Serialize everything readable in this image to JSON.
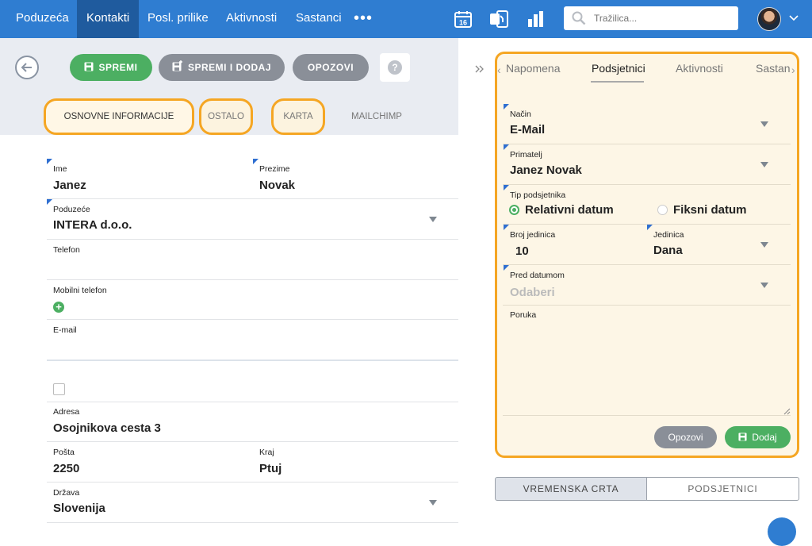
{
  "topnav": {
    "items": [
      "Poduzeća",
      "Kontakti",
      "Posl. prilike",
      "Aktivnosti",
      "Sastanci"
    ],
    "active_index": 1,
    "more_label": "•••",
    "search_placeholder": "Tražilica...",
    "calendar_day": "16"
  },
  "toolbar": {
    "save_label": "SPREMI",
    "save_add_label": "SPREMI I DODAJ",
    "cancel_label": "OPOZOVI",
    "help_label": "?"
  },
  "form_tabs": [
    "OSNOVNE INFORMACIJE",
    "OSTALO",
    "KARTA",
    "MAILCHIMP"
  ],
  "form": {
    "ime_label": "Ime",
    "ime_value": "Janez",
    "prezime_label": "Prezime",
    "prezime_value": "Novak",
    "poduzece_label": "Poduzeće",
    "poduzece_value": "INTERA d.o.o.",
    "telefon_label": "Telefon",
    "mobilni_label": "Mobilni telefon",
    "email_label": "E-mail",
    "adresa_label": "Adresa",
    "adresa_value": "Osojnikova cesta 3",
    "posta_label": "Pošta",
    "posta_value": "2250",
    "kraj_label": "Kraj",
    "kraj_value": "Ptuj",
    "drzava_label": "Država",
    "drzava_value": "Slovenija"
  },
  "right_tabs": [
    "Napomena",
    "Podsjetnici",
    "Aktivnosti",
    "Sastan"
  ],
  "reminder": {
    "nacin_label": "Način",
    "nacin_value": "E-Mail",
    "primatelj_label": "Primatelj",
    "primatelj_value": "Janez Novak",
    "tip_label": "Tip podsjetnika",
    "opt_relativni": "Relativni datum",
    "opt_fiksni": "Fiksni datum",
    "broj_label": "Broj jedinica",
    "broj_value": "10",
    "jedinica_label": "Jedinica",
    "jedinica_value": "Dana",
    "pred_label": "Pred datumom",
    "pred_placeholder": "Odaberi",
    "poruka_label": "Poruka",
    "cancel_label": "Opozovi",
    "add_label": "Dodaj"
  },
  "bottom_tabs": [
    "VREMENSKA CRTA",
    "PODSJETNICI"
  ],
  "colors": {
    "nav": "#2f7dd1",
    "nav_active": "#1f5b9e",
    "green": "#4caf62",
    "grey_btn": "#8a8f98",
    "highlight": "#f5a623"
  }
}
